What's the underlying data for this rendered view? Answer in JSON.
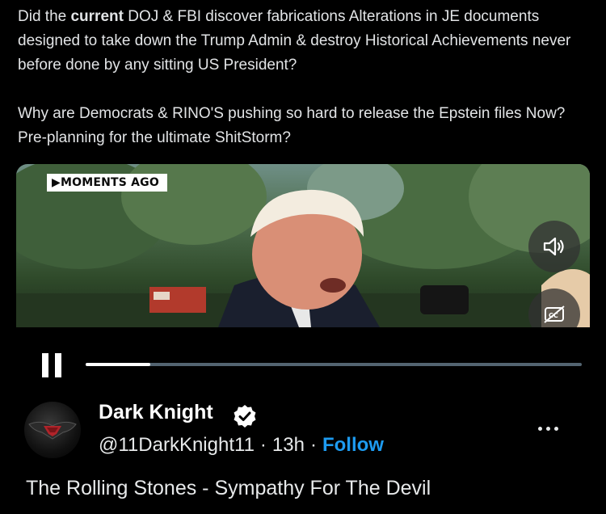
{
  "tweet": {
    "p1_pre": "Did the ",
    "p1_bold": "current",
    "p1_post": " DOJ & FBI discover fabrications Alterations in JE documents designed to take down the Trump Admin & destroy Historical Achievements never before done by any sitting US President?",
    "p2": "Why are Democrats & RINO'S pushing so hard to release the Epstein files Now? Pre-planning for the ultimate ShitStorm?"
  },
  "video": {
    "badge": "▶MOMENTS AGO",
    "progress": 0.13,
    "mute_icon": "speaker-icon",
    "cc_icon": "captions-off-icon",
    "pause_icon": "pause-icon"
  },
  "author": {
    "name": "Dark Knight",
    "handle": "@11DarkKnight11",
    "sep1": "·",
    "time": "13h",
    "sep2": "·",
    "follow": "Follow",
    "verified_color": "#ffffff",
    "follow_color": "#1d9bf0"
  },
  "caption": "The Rolling Stones - Sympathy For The Devil"
}
